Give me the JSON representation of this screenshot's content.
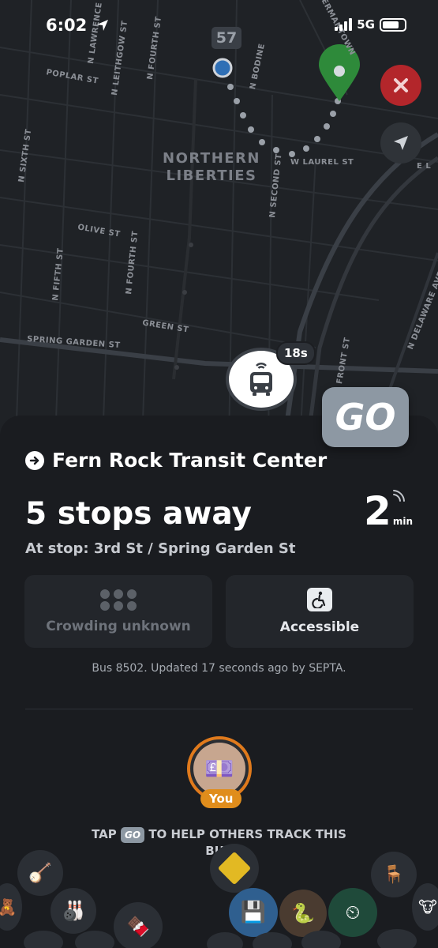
{
  "status": {
    "time": "6:02",
    "network": "5G"
  },
  "map": {
    "route_number": "57",
    "neighborhood_line1": "NORTHERN",
    "neighborhood_line2": "LIBERTIES",
    "streets": {
      "poplar": "POPLAR ST",
      "n_lawrence": "N LAWRENCE ST",
      "n_leithgow": "N LEITHGOW ST",
      "n_fourth_top": "N FOURTH ST",
      "n_bodine": "N BODINE",
      "germantown": "GERMANTOWN",
      "n_sixth": "N SIXTH ST",
      "w_laurel": "W LAUREL ST",
      "n_second": "N SECOND ST",
      "e_l": "E L",
      "olive": "OLIVE ST",
      "n_fifth": "N FIFTH ST",
      "n_fourth": "N FOURTH ST",
      "n_delaware": "N DELAWARE AVE",
      "green": "GREEN ST",
      "spring_garden": "SPRING GARDEN ST",
      "front": "FRONT ST"
    },
    "bus_seconds": "18s",
    "close_icon": "close-icon",
    "locate_icon": "location-arrow-icon"
  },
  "go_button": "GO",
  "trip": {
    "destination": "Fern Rock Transit Center",
    "stops_away": "5 stops away",
    "at_stop": "At stop: 3rd St / Spring Garden St",
    "eta_value": "2",
    "eta_unit": "min"
  },
  "crowding": {
    "label": "Crowding unknown"
  },
  "accessibility": {
    "label": "Accessible"
  },
  "updated": "Bus 8502. Updated 17 seconds ago by SEPTA.",
  "you": {
    "badge": "You"
  },
  "tap": {
    "before": "TAP",
    "pill": "GO",
    "after": "TO HELP OTHERS TRACK THIS BUS"
  },
  "colors": {
    "go": "#8d98a3",
    "close": "#b3262b",
    "you_ring": "#e07a1c",
    "pin": "#2e8a3a"
  }
}
